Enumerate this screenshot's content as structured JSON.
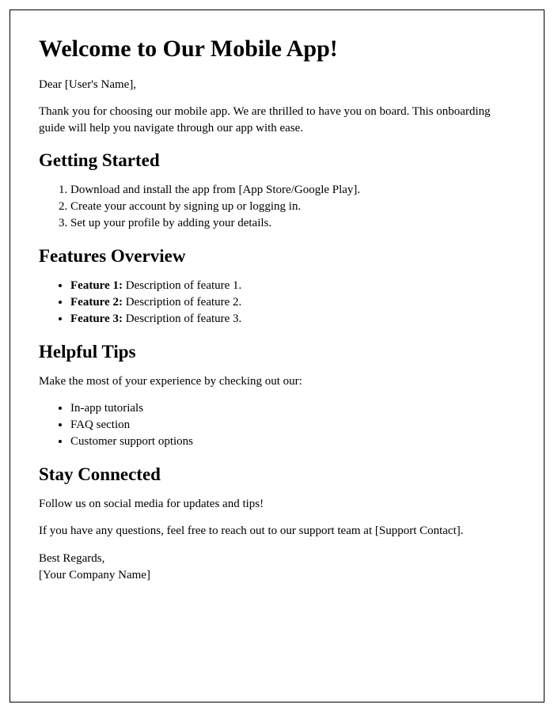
{
  "title": "Welcome to Our Mobile App!",
  "greeting": "Dear [User's Name],",
  "intro": "Thank you for choosing our mobile app. We are thrilled to have you on board. This onboarding guide will help you navigate through our app with ease.",
  "sections": {
    "getting_started": {
      "heading": "Getting Started",
      "steps": [
        "Download and install the app from [App Store/Google Play].",
        "Create your account by signing up or logging in.",
        "Set up your profile by adding your details."
      ]
    },
    "features": {
      "heading": "Features Overview",
      "items": [
        {
          "label": "Feature 1:",
          "desc": " Description of feature 1."
        },
        {
          "label": "Feature 2:",
          "desc": " Description of feature 2."
        },
        {
          "label": "Feature 3:",
          "desc": " Description of feature 3."
        }
      ]
    },
    "tips": {
      "heading": "Helpful Tips",
      "intro": "Make the most of your experience by checking out our:",
      "items": [
        "In-app tutorials",
        "FAQ section",
        "Customer support options"
      ]
    },
    "connected": {
      "heading": "Stay Connected",
      "line1": "Follow us on social media for updates and tips!",
      "line2": "If you have any questions, feel free to reach out to our support team at [Support Contact]."
    }
  },
  "signoff": {
    "regards": "Best Regards,",
    "company": "[Your Company Name]"
  }
}
